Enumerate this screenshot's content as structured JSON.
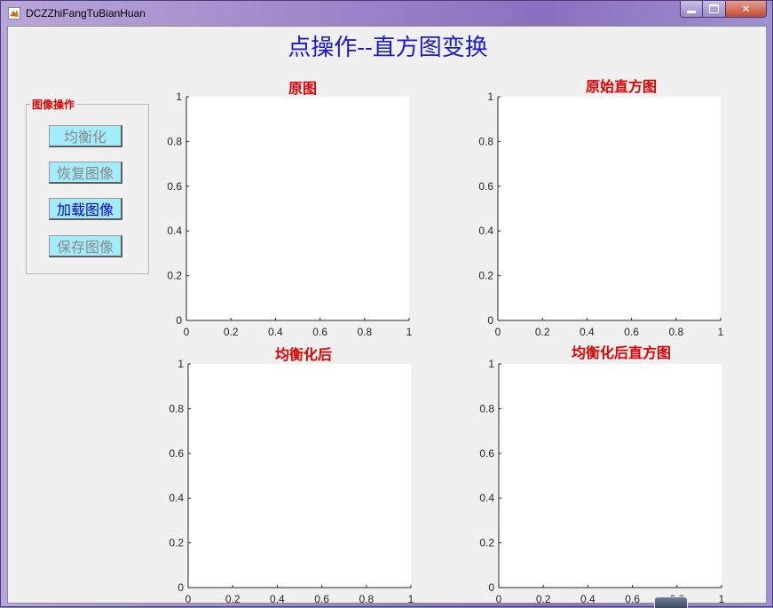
{
  "window": {
    "title": "DCZZhiFangTuBianHuan"
  },
  "main": {
    "title": "点操作--直方图变换"
  },
  "panel": {
    "title": "图像操作",
    "buttons": [
      {
        "label": "均衡化",
        "enabled": false
      },
      {
        "label": "恢复图像",
        "enabled": false
      },
      {
        "label": "加载图像",
        "enabled": true
      },
      {
        "label": "保存图像",
        "enabled": false
      }
    ]
  },
  "axes": [
    {
      "title": "原图"
    },
    {
      "title": "原始直方图"
    },
    {
      "title": "均衡化后"
    },
    {
      "title": "均衡化后直方图"
    }
  ],
  "ticks": {
    "x": [
      "0",
      "0.2",
      "0.4",
      "0.6",
      "0.8",
      "1"
    ],
    "y": [
      "0",
      "0.2",
      "0.4",
      "0.6",
      "0.8",
      "1"
    ]
  },
  "colors": {
    "title": "#1a1ad6",
    "axes_title": "#e00000",
    "button_bg": "#a3ecfb",
    "button_disabled_text": "#8a8a8a",
    "button_active_text": "#0000cc"
  }
}
